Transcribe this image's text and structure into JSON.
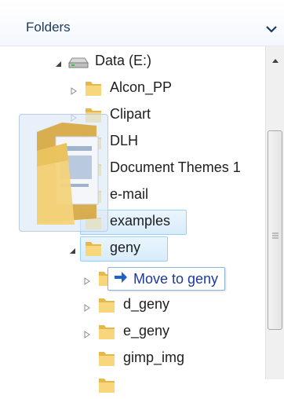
{
  "header": {
    "title": "Folders",
    "chevron_icon": "chevron-down-icon"
  },
  "tree": {
    "drive": {
      "label": "Data (E:)",
      "icon": "drive-icon",
      "expanded": true
    },
    "items": [
      {
        "label": "Alcon_PP"
      },
      {
        "label": "Clipart"
      },
      {
        "label": "DLH"
      },
      {
        "label": "Document Themes 1"
      },
      {
        "label": "e-mail"
      },
      {
        "label": "examples"
      },
      {
        "label": "geny"
      },
      {
        "label": ""
      },
      {
        "label": "d_geny"
      },
      {
        "label": "e_geny"
      },
      {
        "label": "gimp_img"
      }
    ]
  },
  "drag_tooltip": {
    "icon": "arrow-right-icon",
    "label": "Move to geny"
  },
  "colors": {
    "header_text": "#1e395b",
    "selection_border": "#99d1f6",
    "tooltip_text": "#1d3a9b"
  }
}
